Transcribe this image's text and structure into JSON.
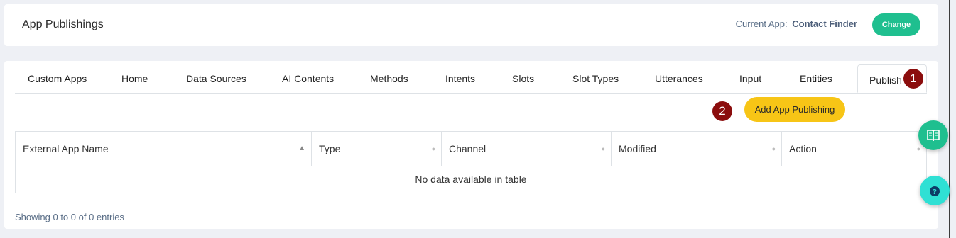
{
  "header": {
    "title": "App Publishings",
    "current_app_label": "Current App:",
    "current_app_name": "Contact Finder",
    "change_button": "Change"
  },
  "tabs": [
    {
      "label": "Custom Apps"
    },
    {
      "label": "Home"
    },
    {
      "label": "Data Sources"
    },
    {
      "label": "AI Contents"
    },
    {
      "label": "Methods"
    },
    {
      "label": "Intents"
    },
    {
      "label": "Slots"
    },
    {
      "label": "Slot Types"
    },
    {
      "label": "Utterances"
    },
    {
      "label": "Input"
    },
    {
      "label": "Entities"
    },
    {
      "label": "Publish",
      "active": true
    }
  ],
  "markers": {
    "first": "1",
    "second": "2"
  },
  "add_button": "Add App Publishing",
  "table": {
    "columns": [
      {
        "label": "External App Name",
        "sorted": "asc"
      },
      {
        "label": "Type"
      },
      {
        "label": "Channel"
      },
      {
        "label": "Modified"
      },
      {
        "label": "Action"
      }
    ],
    "empty_message": "No data available in table"
  },
  "table_info": "Showing 0 to 0 of 0 entries",
  "floating": {
    "book_icon": "book-icon",
    "help_icon": "question-icon"
  },
  "colors": {
    "primary_green": "#1fbf8f",
    "accent_yellow": "#f7c516",
    "marker_red": "#8b0d0d",
    "help_teal": "#2fe0d4"
  }
}
